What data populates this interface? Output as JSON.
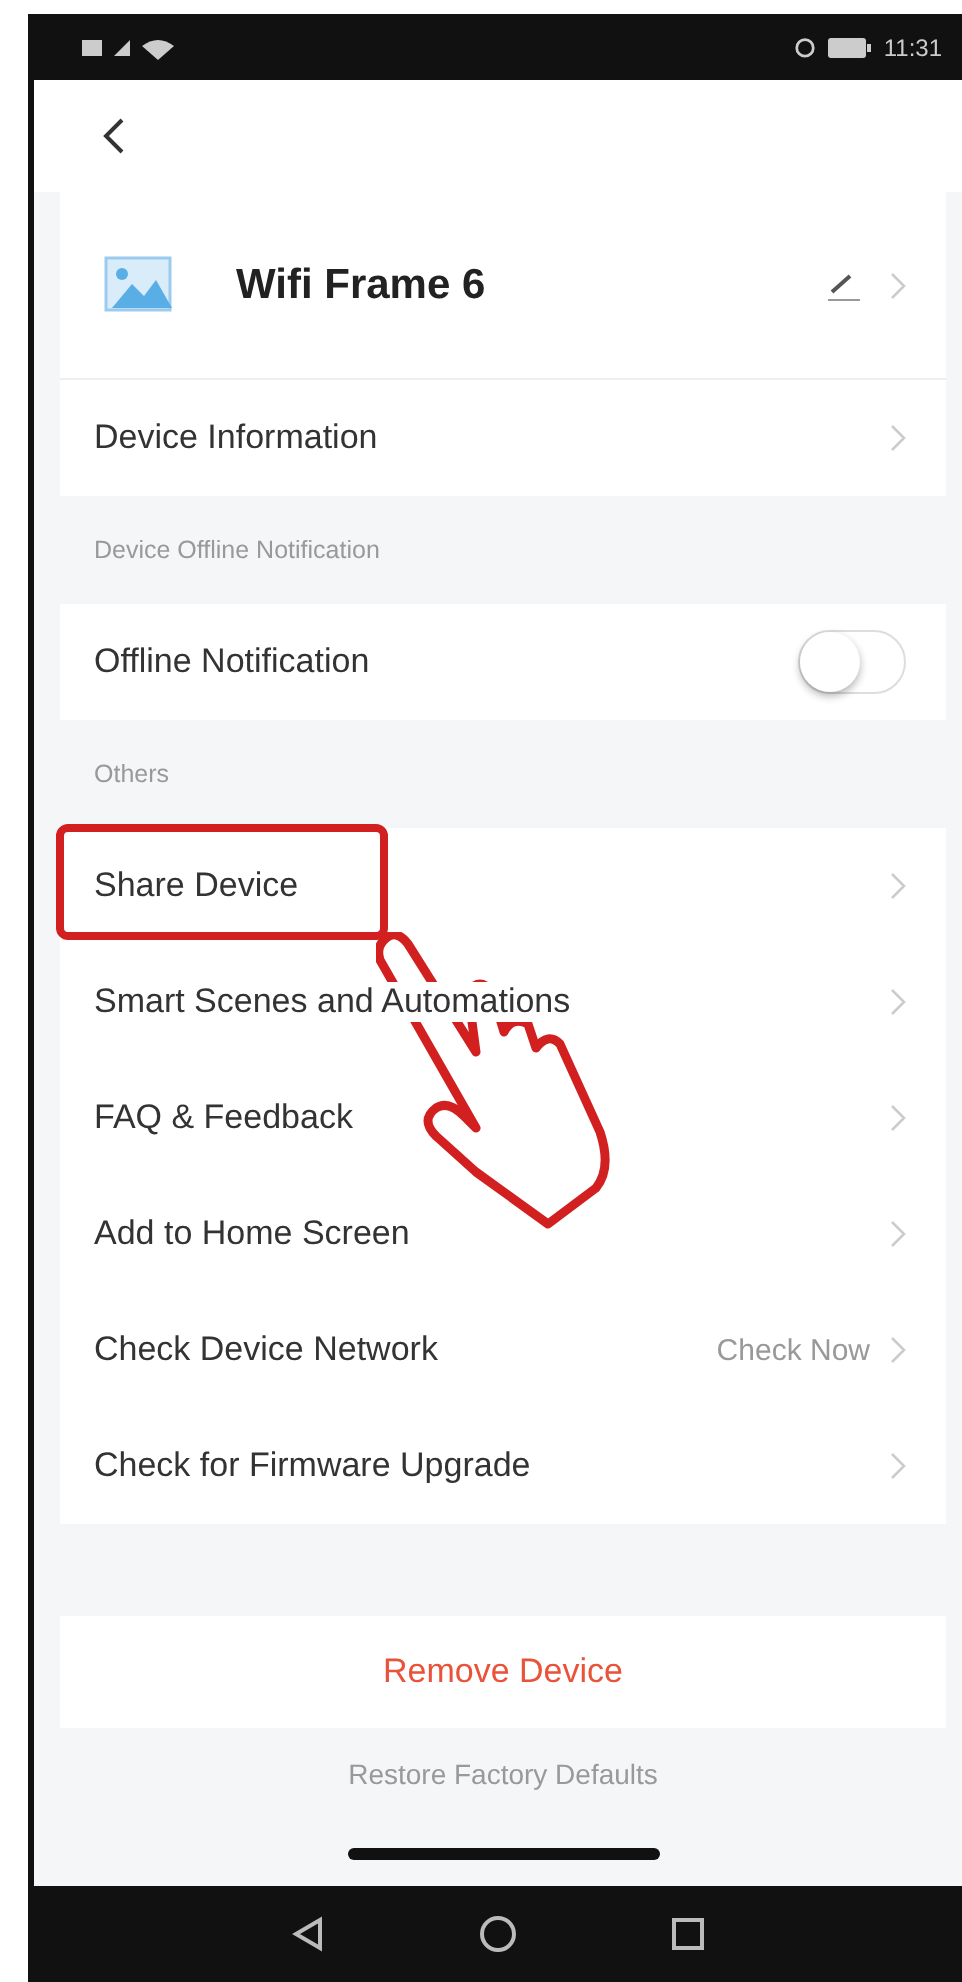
{
  "status_bar": {
    "time": "11:31"
  },
  "device": {
    "name": "Wifi Frame 6"
  },
  "sections": [
    {
      "rows": [
        {
          "kind": "link",
          "label": "Device Information"
        }
      ]
    },
    {
      "header": "Device Offline Notification",
      "rows": [
        {
          "kind": "toggle",
          "label": "Offline Notification",
          "on": false
        }
      ]
    },
    {
      "header": "Others",
      "rows": [
        {
          "kind": "link",
          "label": "Share Device",
          "highlighted": true
        },
        {
          "kind": "link",
          "label": "Smart Scenes and Automations"
        },
        {
          "kind": "link",
          "label": "FAQ & Feedback"
        },
        {
          "kind": "link",
          "label": "Add to Home Screen"
        },
        {
          "kind": "link",
          "label": "Check Device Network",
          "value": "Check Now"
        },
        {
          "kind": "link",
          "label": "Check for Firmware Upgrade"
        }
      ]
    }
  ],
  "remove_button": "Remove Device",
  "restore_link": "Restore Factory Defaults"
}
